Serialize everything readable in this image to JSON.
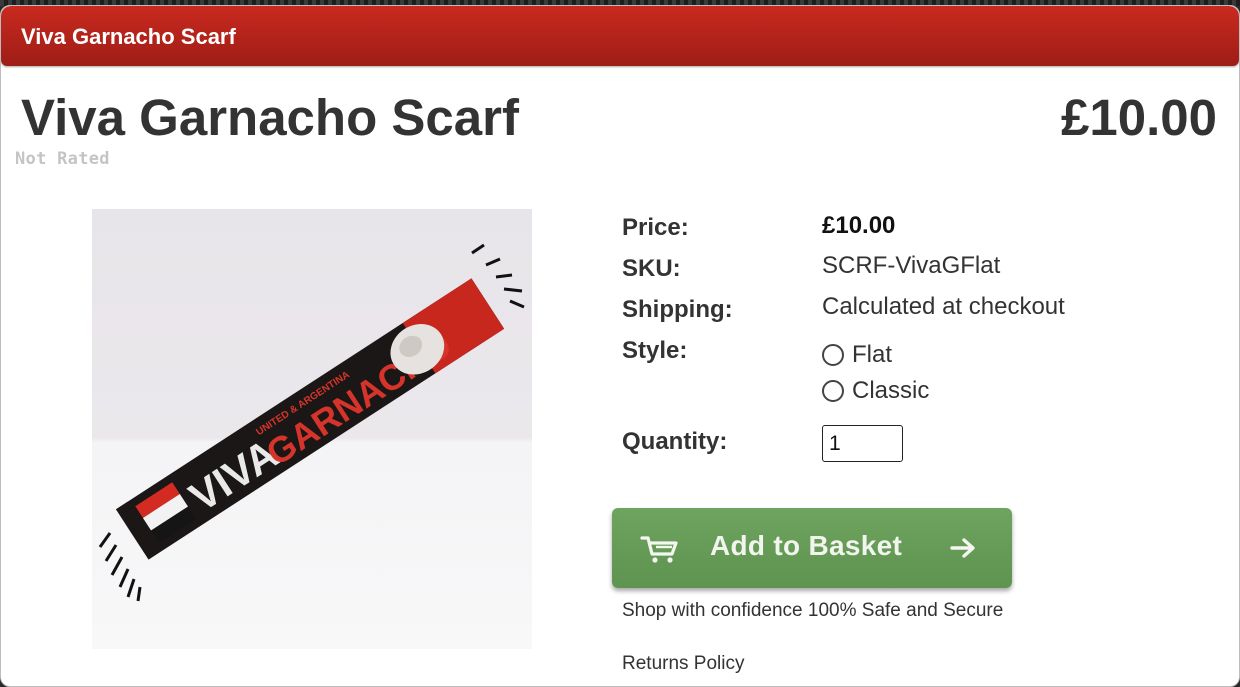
{
  "header": {
    "title": "Viva Garnacho Scarf"
  },
  "product": {
    "title": "Viva Garnacho Scarf",
    "price_display": "£10.00",
    "rating_text": "Not Rated",
    "image": {
      "scarf_text_1": "VIVA",
      "scarf_text_2": "GARNACHO",
      "scarf_text_3": "UNITED & ARGENTINA"
    },
    "details": {
      "price_label": "Price:",
      "price_value": "£10.00",
      "sku_label": "SKU:",
      "sku_value": "SCRF-VivaGFlat",
      "shipping_label": "Shipping:",
      "shipping_value": "Calculated at checkout",
      "style_label": "Style:",
      "style_options": [
        "Flat",
        "Classic"
      ],
      "quantity_label": "Quantity:",
      "quantity_value": "1"
    }
  },
  "actions": {
    "add_to_basket_label": "Add to Basket",
    "confidence_text": "Shop with confidence 100% Safe and Secure",
    "returns_text": "Returns Policy"
  },
  "colors": {
    "header_red": "#b0221a",
    "button_green": "#6ea45e",
    "text_dark": "#333333"
  },
  "icons": [
    "cart-icon",
    "arrow-right-icon"
  ]
}
